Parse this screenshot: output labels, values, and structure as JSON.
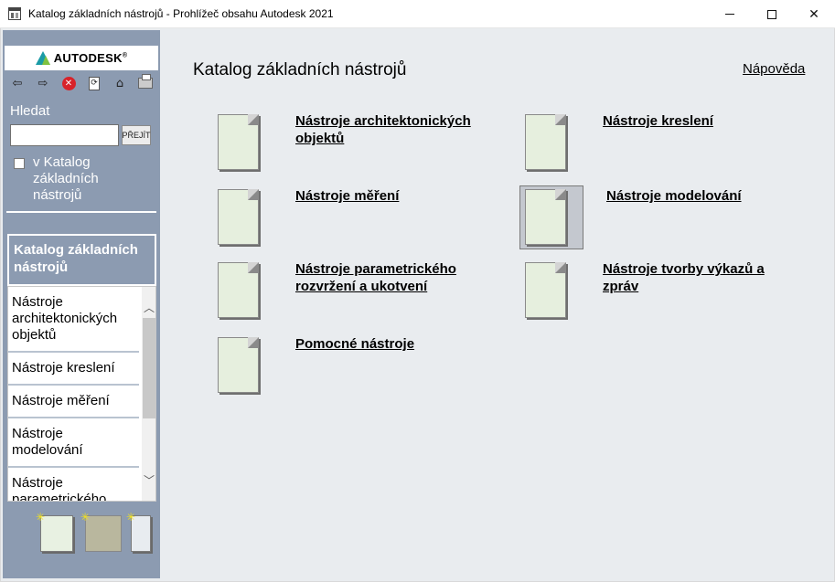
{
  "window": {
    "title": "Katalog základních nástrojů - Prohlížeč obsahu Autodesk 2021",
    "close_glyph": "✕"
  },
  "sidebar": {
    "logo_text": "AUTODESK",
    "logo_tm": "®",
    "toolbar": {
      "back_glyph": "⇦",
      "forward_glyph": "⇨",
      "stop_glyph": "✕",
      "refresh_glyph": "⟳",
      "home_glyph": "⌂"
    },
    "search": {
      "label": "Hledat",
      "value": "",
      "button_label": "PŘEJÍT",
      "scope_label": "v Katalog základních nástrojů",
      "scope_checked": false
    },
    "current_catalog": "Katalog základních nástrojů",
    "list_items": [
      "Nástroje architektonických objektů",
      "Nástroje kreslení",
      "Nástroje měření",
      "Nástroje modelování",
      "Nástroje parametrického rozvržení a ukotvení"
    ],
    "scroll_up_glyph": "︿",
    "scroll_down_glyph": "﹀",
    "spark_glyph": "✳"
  },
  "main": {
    "title": "Katalog základních nástrojů",
    "help_link": "Nápověda",
    "tools": [
      {
        "label": "Nástroje architektonických objektů",
        "line1": "Nástroje architektonických",
        "line2": "objektů",
        "selected": false
      },
      {
        "label": "Nástroje kreslení",
        "line1": "Nástroje kreslení",
        "line2": "",
        "selected": false
      },
      {
        "label": "Nástroje měření",
        "line1": "Nástroje měření",
        "line2": "",
        "selected": false
      },
      {
        "label": "Nástroje modelování",
        "line1": "Nástroje modelování",
        "line2": "",
        "selected": true
      },
      {
        "label": "Nástroje parametrického rozvržení a ukotvení",
        "line1": "Nástroje parametrického",
        "line2": "rozvržení a ukotvení",
        "selected": false
      },
      {
        "label": "Nástroje tvorby výkazů a zpráv",
        "line1": "Nástroje tvorby výkazů a",
        "line2": "zpráv",
        "selected": false
      },
      {
        "label": "Pomocné nástroje",
        "line1": "Pomocné nástroje",
        "line2": "",
        "selected": false
      }
    ]
  }
}
